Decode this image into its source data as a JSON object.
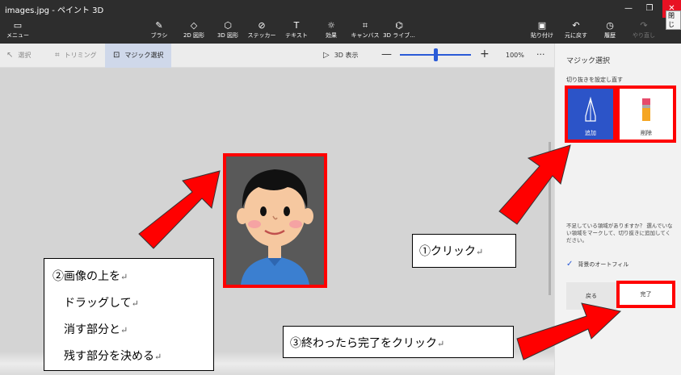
{
  "window": {
    "title": "images.jpg - ペイント 3D",
    "close_tooltip": "閉じ"
  },
  "ribbon": {
    "menu": "メニュー",
    "tools": [
      {
        "icon": "brush-icon",
        "label": "ブラシ"
      },
      {
        "icon": "shapes-2d-icon",
        "label": "2D 図形"
      },
      {
        "icon": "shapes-3d-icon",
        "label": "3D 図形"
      },
      {
        "icon": "sticker-icon",
        "label": "ステッカー"
      },
      {
        "icon": "text-icon",
        "label": "テキスト"
      },
      {
        "icon": "effects-icon",
        "label": "効果"
      },
      {
        "icon": "canvas-icon",
        "label": "キャンバス"
      },
      {
        "icon": "library-3d-icon",
        "label": "3D ライブ..."
      }
    ],
    "paste": "貼り付け",
    "undo": "元に戻す",
    "history": "履歴",
    "redo": "やり直し"
  },
  "toolbar": {
    "select": "選択",
    "crop": "トリミング",
    "magic_select": "マジック選択",
    "view_3d": "3D 表示",
    "zoom": "100%",
    "zoom_level": 0.5
  },
  "panel": {
    "title": "マジック選択",
    "subtitle": "切り抜きを設定し直す",
    "add": "追加",
    "remove": "削除",
    "note": "不足している領域がありますか？ 選んでいない領域をマークして、切り抜きに追加してください。",
    "autofill": "背景のオートフィル",
    "back": "戻る",
    "done": "完了"
  },
  "annotations": {
    "step1": "①クリック",
    "step2_lines": [
      "②画像の上を",
      "ドラッグして",
      "消す部分と",
      "残す部分を決める"
    ],
    "step3": "③終わったら完了をクリック",
    "return_mark": "↵"
  },
  "colors": {
    "annotation_red": "#ff0000",
    "accent_blue": "#2c54c8",
    "ribbon_bg": "#2d2d2d"
  }
}
